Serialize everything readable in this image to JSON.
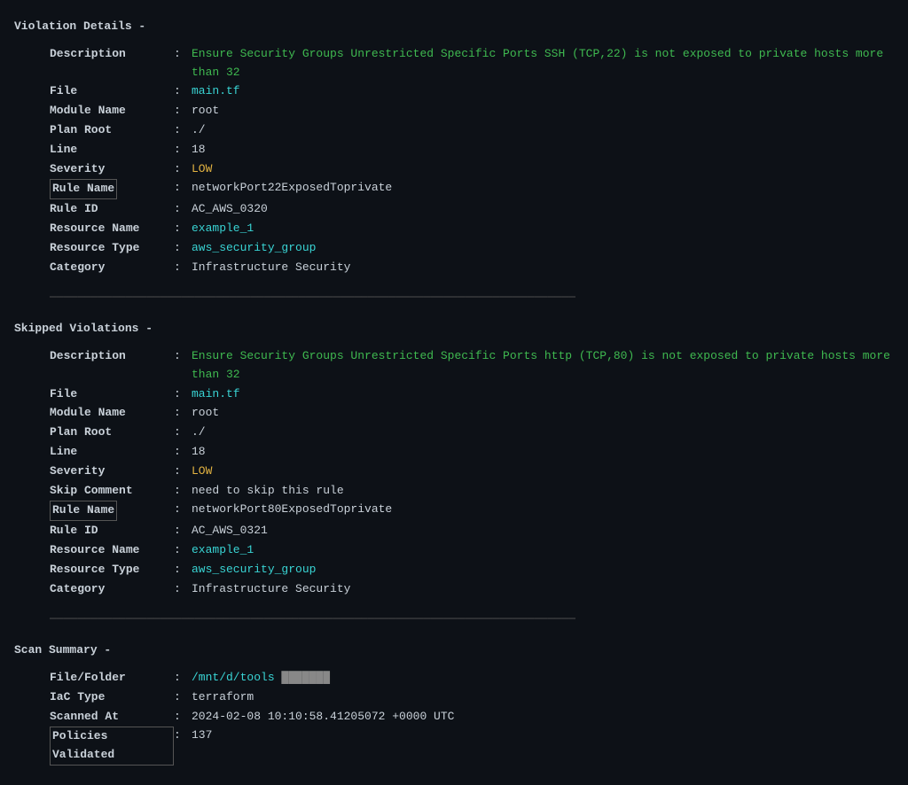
{
  "sections": {
    "violation_details": {
      "title": "Violation Details -",
      "fields": [
        {
          "name": "Description",
          "value": "Ensure Security Groups Unrestricted Specific Ports SSH (TCP,22) is not exposed to private hosts more than 32",
          "style": "green"
        },
        {
          "name": "File",
          "value": "main.tf",
          "style": "cyan"
        },
        {
          "name": "Module Name",
          "value": "root",
          "style": "normal"
        },
        {
          "name": "Plan Root",
          "value": "./",
          "style": "normal"
        },
        {
          "name": "Line",
          "value": "18",
          "style": "normal"
        },
        {
          "name": "Severity",
          "value": "LOW",
          "style": "yellow"
        },
        {
          "name": "Rule Name",
          "value": "networkPort22ExposedToprivate",
          "style": "normal",
          "boxed": true
        },
        {
          "name": "Rule ID",
          "value": "AC_AWS_0320",
          "style": "normal"
        },
        {
          "name": "Resource Name",
          "value": "example_1",
          "style": "cyan"
        },
        {
          "name": "Resource Type",
          "value": "aws_security_group",
          "style": "cyan"
        },
        {
          "name": "Category",
          "value": "Infrastructure Security",
          "style": "normal"
        }
      ]
    },
    "skipped_violations": {
      "title": "Skipped Violations -",
      "fields": [
        {
          "name": "Description",
          "value": "Ensure Security Groups Unrestricted Specific Ports http (TCP,80) is not exposed to private hosts more than 32",
          "style": "green"
        },
        {
          "name": "File",
          "value": "main.tf",
          "style": "cyan"
        },
        {
          "name": "Module Name",
          "value": "root",
          "style": "normal"
        },
        {
          "name": "Plan Root",
          "value": "./",
          "style": "normal"
        },
        {
          "name": "Line",
          "value": "18",
          "style": "normal"
        },
        {
          "name": "Severity",
          "value": "LOW",
          "style": "yellow"
        },
        {
          "name": "Skip Comment",
          "value": "need to skip this rule",
          "style": "normal"
        },
        {
          "name": "Rule Name",
          "value": "networkPort80ExposedToprivate",
          "style": "normal",
          "boxed": true
        },
        {
          "name": "Rule ID",
          "value": "AC_AWS_0321",
          "style": "normal"
        },
        {
          "name": "Resource Name",
          "value": "example_1",
          "style": "cyan"
        },
        {
          "name": "Resource Type",
          "value": "aws_security_group",
          "style": "cyan"
        },
        {
          "name": "Category",
          "value": "Infrastructure Security",
          "style": "normal"
        }
      ]
    },
    "scan_summary": {
      "title": "Scan Summary -",
      "fields": [
        {
          "name": "File/Folder",
          "value": "/mnt/d/tools ███████",
          "style": "cyan",
          "partial_cyan": true,
          "cyan_part": "/mnt/d/tools",
          "normal_part": " ███████"
        },
        {
          "name": "IaC Type",
          "value": "terraform",
          "style": "normal"
        },
        {
          "name": "Scanned At",
          "value": "2024-02-08 10:10:58.41205072 +0000 UTC",
          "style": "normal"
        },
        {
          "name": "Policies Validated",
          "value": "137",
          "style": "normal",
          "boxed": true
        }
      ]
    }
  },
  "divider_char": "────────────────────────────────────────────────────────────────────────────"
}
